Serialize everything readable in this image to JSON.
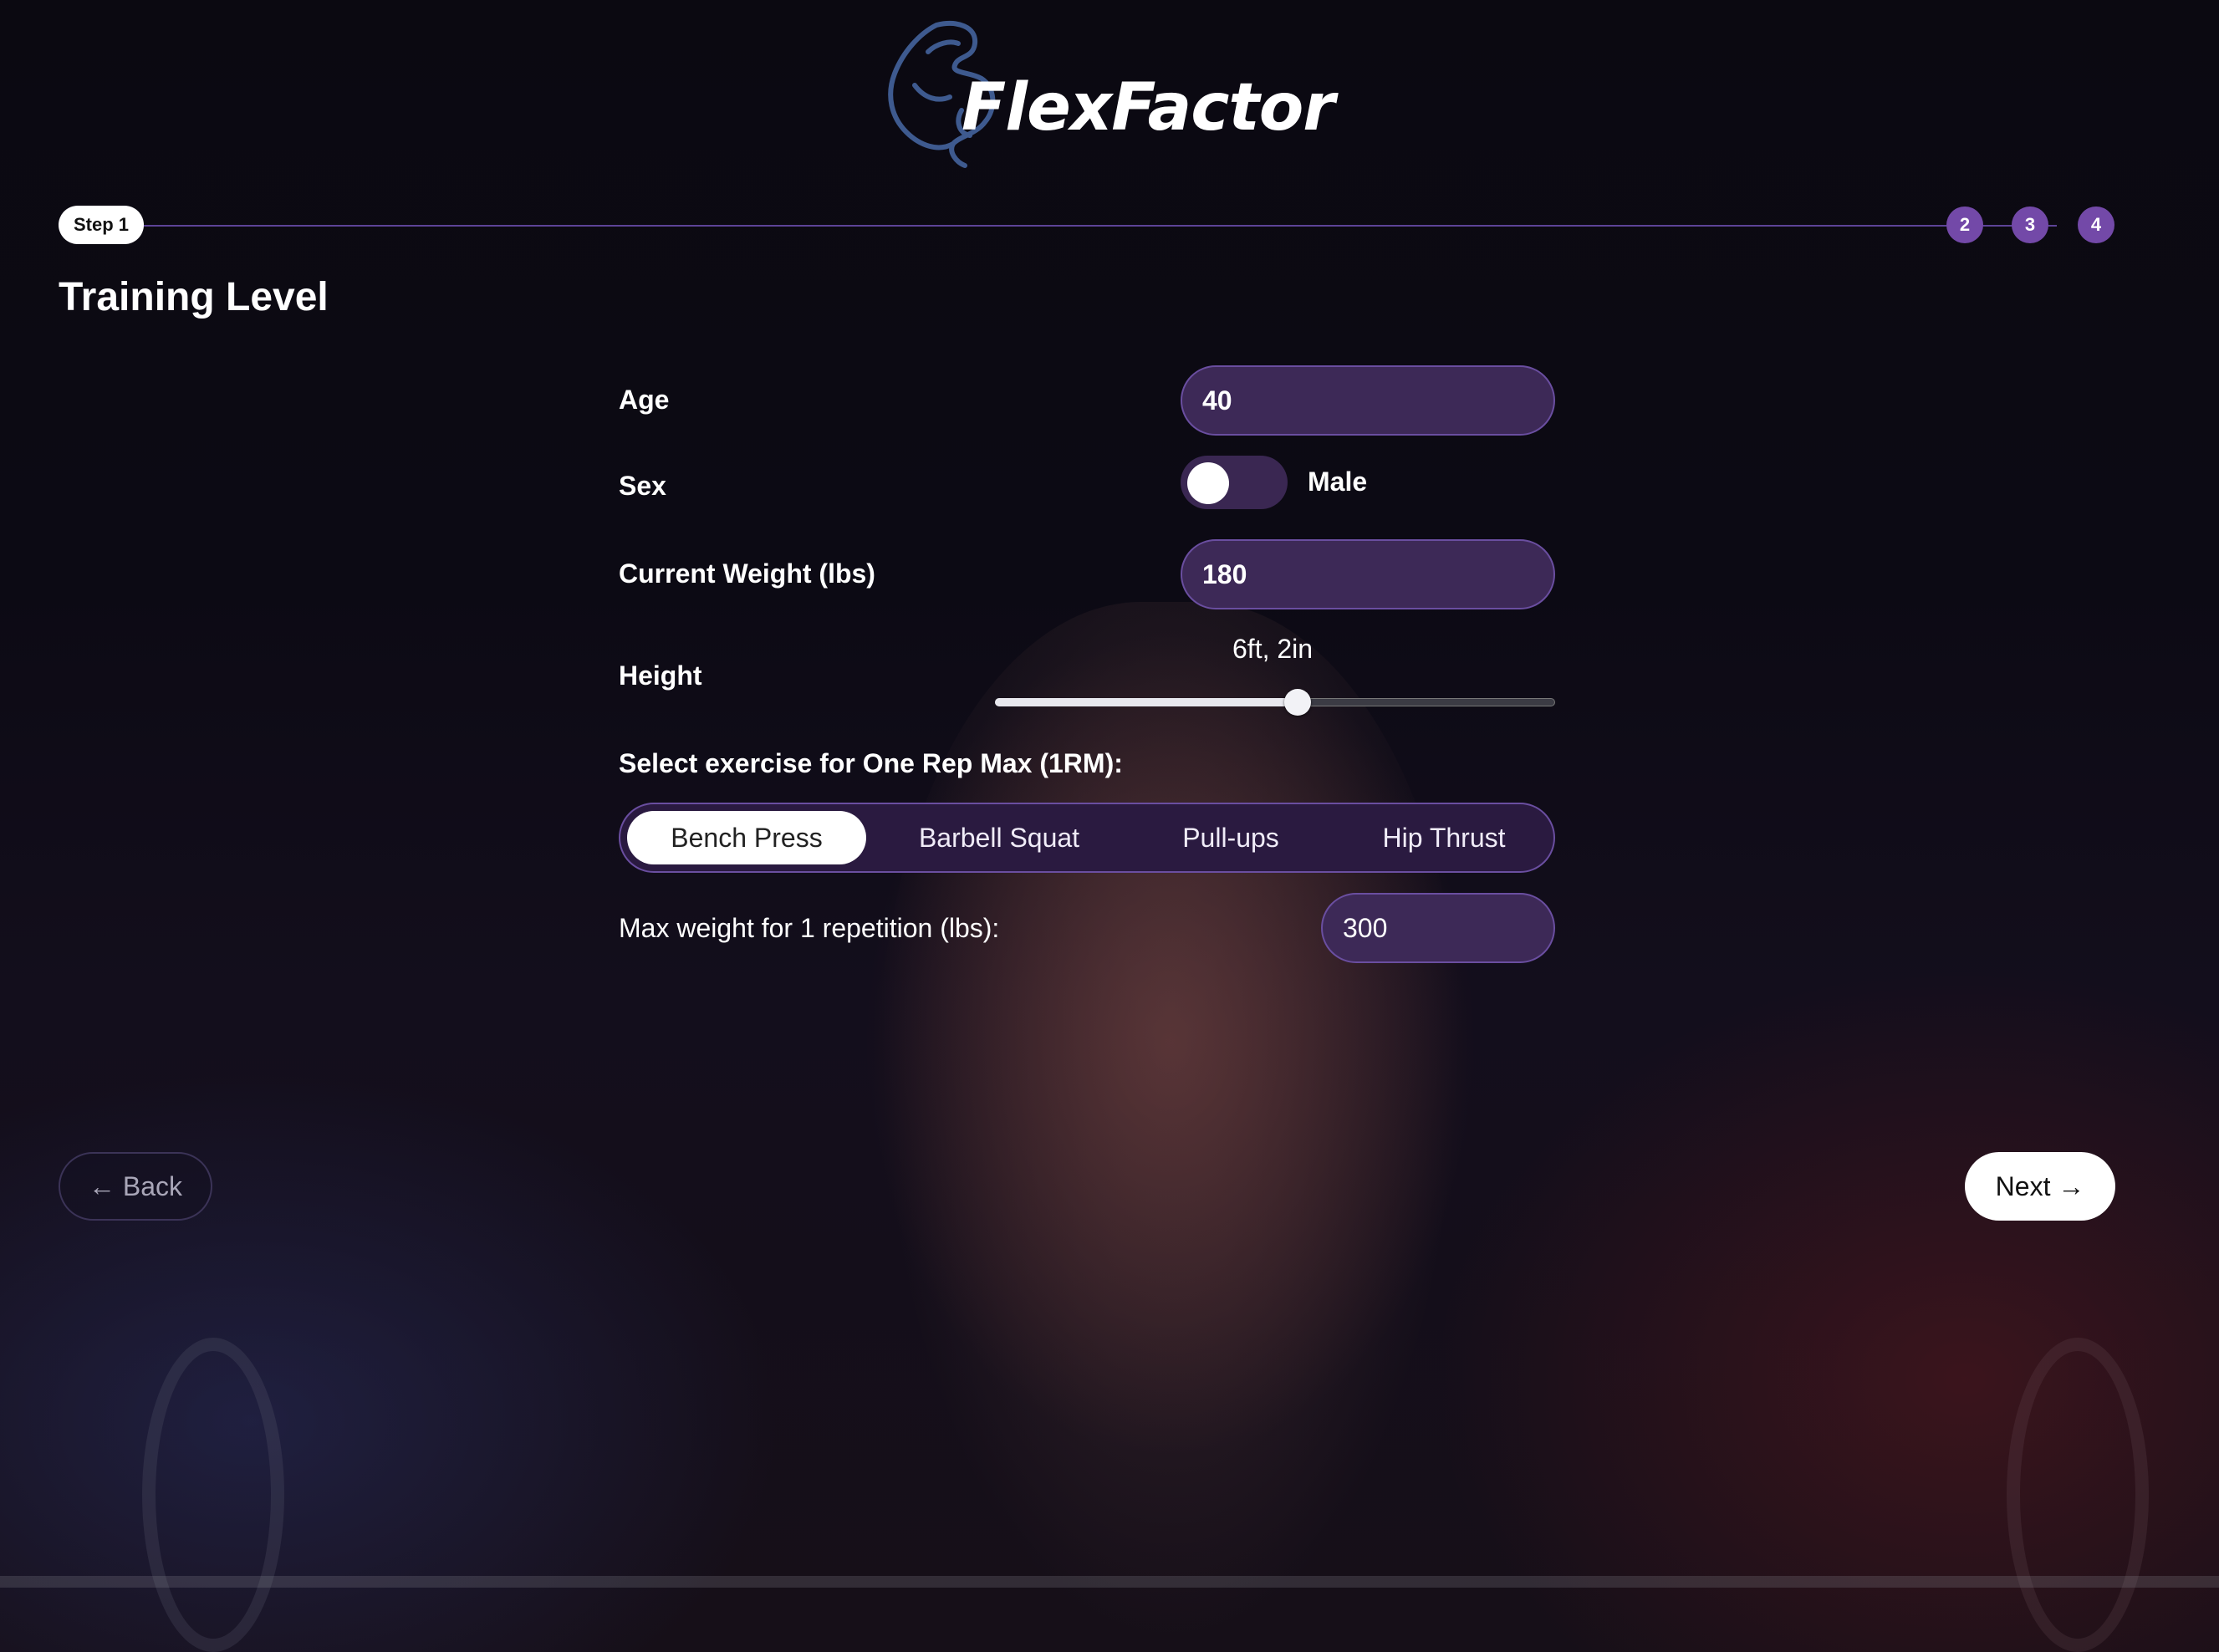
{
  "brand": {
    "name": "FlexFactor",
    "icon": "flexed-arm-icon"
  },
  "stepper": {
    "current_label": "Step 1",
    "steps": [
      "2",
      "3",
      "4"
    ],
    "accent": "#7349a8"
  },
  "page": {
    "title": "Training Level"
  },
  "form": {
    "age": {
      "label": "Age",
      "value": "40"
    },
    "sex": {
      "label": "Sex",
      "value": "Male",
      "toggle_on": false
    },
    "weight": {
      "label": "Current Weight (lbs)",
      "value": "180"
    },
    "height": {
      "label": "Height",
      "display": "6ft, 2in",
      "slider_fraction": 0.54
    },
    "exercise": {
      "label": "Select exercise for One Rep Max (1RM):",
      "options": [
        "Bench Press",
        "Barbell Squat",
        "Pull-ups",
        "Hip Thrust"
      ],
      "selected": "Bench Press"
    },
    "max_weight": {
      "label": "Max weight for 1 repetition (lbs):",
      "value": "300"
    }
  },
  "nav": {
    "back_label": "← Back",
    "next_label": "Next →"
  }
}
